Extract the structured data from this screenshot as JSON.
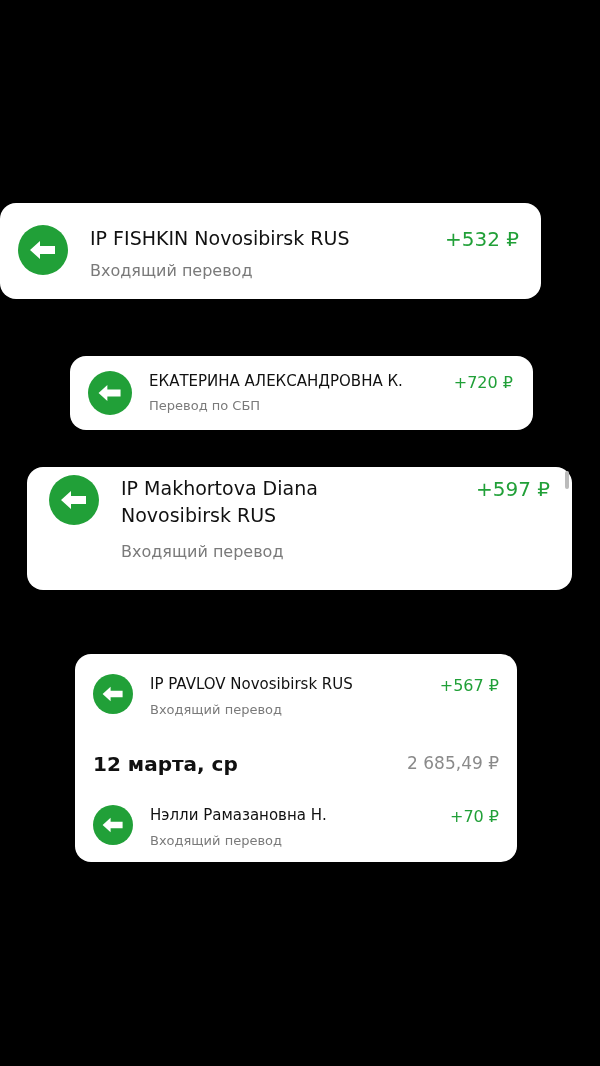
{
  "cards": [
    {
      "items": [
        {
          "kind": "transaction",
          "name": "IP FISHKIN Novosibirsk RUS",
          "description": "Входящий перевод",
          "amount": "+532 ₽"
        }
      ]
    },
    {
      "items": [
        {
          "kind": "transaction",
          "name": "ЕКАТЕРИНА АЛЕКСАНДРОВНА К.",
          "description": "Перевод по СБП",
          "amount": "+720 ₽"
        }
      ]
    },
    {
      "items": [
        {
          "kind": "transaction",
          "name": "IP Makhortova Diana Novosibirsk RUS",
          "description": "Входящий перевод",
          "amount": "+597 ₽"
        }
      ]
    },
    {
      "items": [
        {
          "kind": "transaction",
          "name": "IP PAVLOV Novosibirsk RUS",
          "description": "Входящий перевод",
          "amount": "+567 ₽"
        },
        {
          "kind": "date_header",
          "date": "12 марта, ср",
          "total": "2 685,49 ₽"
        },
        {
          "kind": "transaction",
          "name": "Нэлли Рамазановна Н.",
          "description": "Входящий перевод",
          "amount": "+70 ₽"
        }
      ]
    }
  ]
}
